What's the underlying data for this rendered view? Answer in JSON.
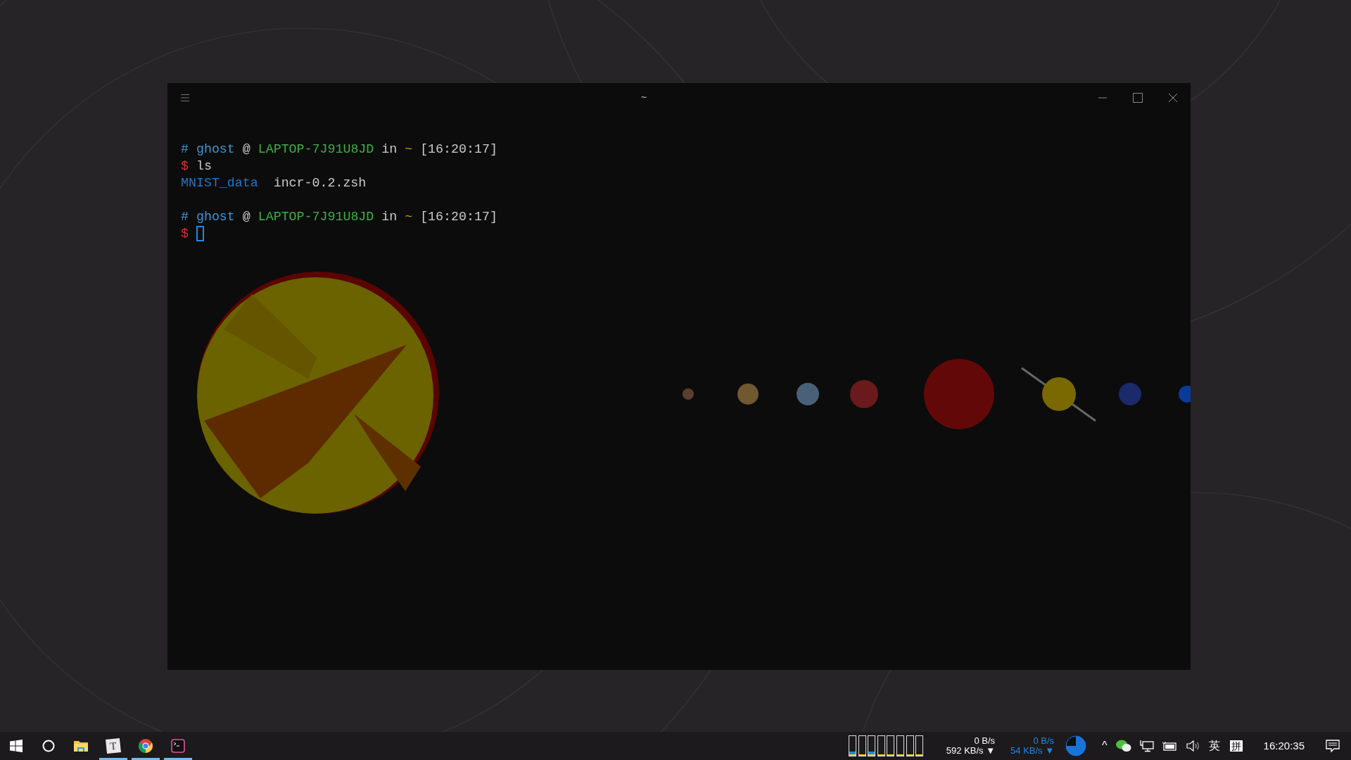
{
  "window": {
    "title": "~"
  },
  "terminal": {
    "blocks": [
      [
        [
          {
            "kind": "hash",
            "text": "#"
          },
          {
            "kind": "user",
            "text": "ghost"
          },
          {
            "kind": "plain",
            "text": "@"
          },
          {
            "kind": "host",
            "text": "LAPTOP-7J91U8JD"
          },
          {
            "kind": "plain",
            "text": "in"
          },
          {
            "kind": "tilde",
            "text": "~"
          },
          {
            "kind": "plain",
            "text": "[16:20:17]"
          }
        ],
        [
          {
            "kind": "dollar",
            "text": "$"
          },
          {
            "kind": "plain",
            "text": "ls"
          }
        ],
        [
          {
            "kind": "dir",
            "text": "MNIST_data"
          },
          {
            "kind": "plain",
            "text": "incr-0.2.zsh"
          }
        ]
      ],
      [
        [
          {
            "kind": "hash",
            "text": "#"
          },
          {
            "kind": "user",
            "text": "ghost"
          },
          {
            "kind": "plain",
            "text": "@"
          },
          {
            "kind": "host",
            "text": "LAPTOP-7J91U8JD"
          },
          {
            "kind": "plain",
            "text": "in"
          },
          {
            "kind": "tilde",
            "text": "~"
          },
          {
            "kind": "plain",
            "text": "[16:20:17]"
          }
        ],
        [
          {
            "kind": "dollar",
            "text": "$"
          },
          {
            "kind": "cursor"
          }
        ]
      ]
    ]
  },
  "taskbar": {
    "apps": [
      {
        "kind": "start",
        "running": false
      },
      {
        "kind": "cortana",
        "running": false
      },
      {
        "kind": "explorer",
        "running": false
      },
      {
        "kind": "typora",
        "glyph": "T",
        "running": true
      },
      {
        "kind": "chrome",
        "running": true
      },
      {
        "kind": "terminal",
        "running": true
      }
    ],
    "cpu_meter": [
      {
        "level": 0.22
      },
      {
        "level": 0.04
      },
      {
        "level": 0.22
      },
      {
        "level": 0.04
      },
      {
        "level": 0.04
      },
      {
        "level": 0.04
      },
      {
        "level": 0.04
      },
      {
        "level": 0.04
      }
    ],
    "network": [
      {
        "upload": "0 B/s",
        "download": "592 KB/s",
        "arrow": "▼",
        "color": "#ffffff"
      },
      {
        "upload": "0 B/s",
        "download": "54 KB/s",
        "arrow": "▼",
        "color": "#1e88e5"
      }
    ],
    "tray_caret": "^",
    "language": "英",
    "ime": "拼",
    "clock": "16:20:35"
  }
}
